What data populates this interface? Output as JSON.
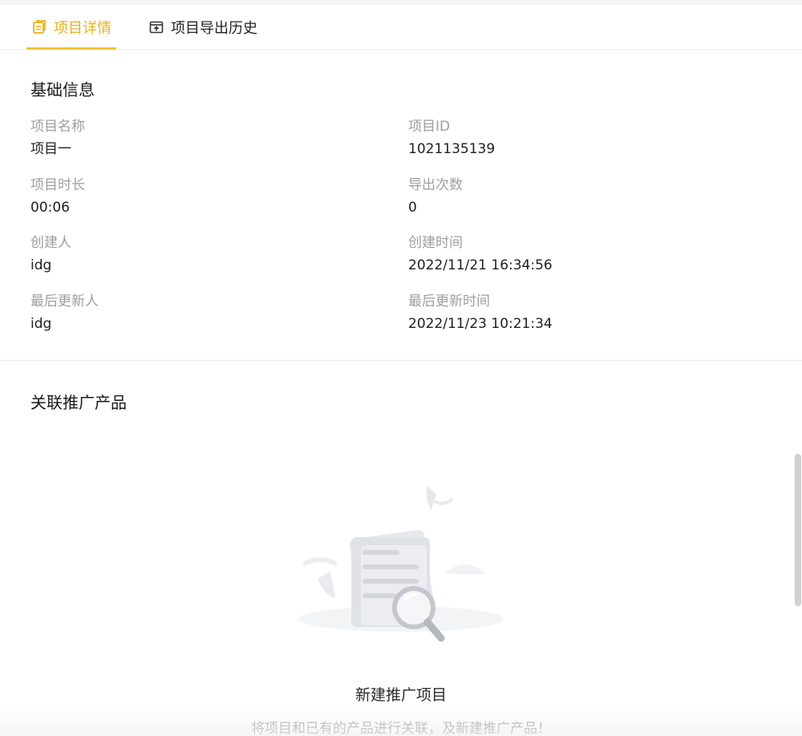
{
  "tabs": [
    {
      "label": "项目详情",
      "icon": "document-icon",
      "active": true
    },
    {
      "label": "项目导出历史",
      "icon": "export-box-icon",
      "active": false
    }
  ],
  "basic_info": {
    "title": "基础信息",
    "fields": [
      {
        "label": "项目名称",
        "value": "项目一"
      },
      {
        "label": "项目ID",
        "value": "1021135139"
      },
      {
        "label": "项目时长",
        "value": "00:06"
      },
      {
        "label": "导出次数",
        "value": "0"
      },
      {
        "label": "创建人",
        "value": "idg"
      },
      {
        "label": "创建时间",
        "value": "2022/11/21 16:34:56"
      },
      {
        "label": "最后更新人",
        "value": "idg"
      },
      {
        "label": "最后更新时间",
        "value": "2022/11/23 10:21:34"
      }
    ]
  },
  "related_products": {
    "title": "关联推广产品",
    "empty": {
      "title": "新建推广项目",
      "description": "将项目和已有的产品进行关联，及新建推广产品！",
      "illustration": "empty-document-search-illustration"
    }
  },
  "colors": {
    "accent": "#f2c231",
    "accent_text": "#e8b21c",
    "label_gray": "#9e9e9e",
    "divider": "#ebebeb"
  }
}
